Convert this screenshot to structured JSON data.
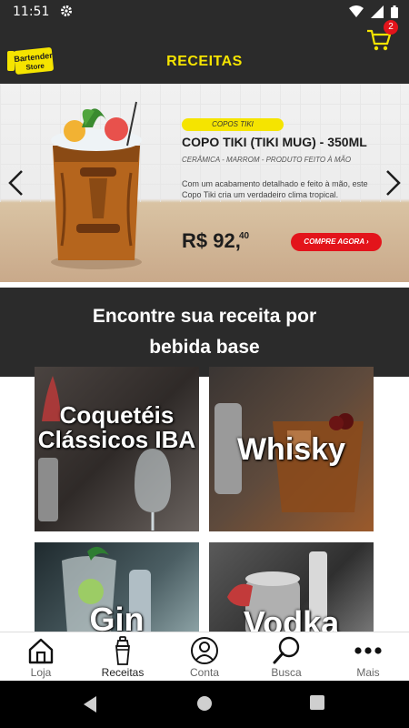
{
  "status_bar": {
    "time": "11:51",
    "icons": [
      "gear-icon",
      "wifi-icon",
      "signal-icon",
      "battery-icon"
    ]
  },
  "header": {
    "logo_text_top": "Bartender",
    "logo_text_bottom": "Store",
    "title": "RECEITAS",
    "cart_count": "2",
    "accent_color": "#f5e400"
  },
  "banner": {
    "category": "COPOS TIKI",
    "product_title": "COPO TIKI (TIKI MUG) - 350ML",
    "product_subtitle": "CERÂMICA - MARROM - PRODUTO FEITO À MÃO",
    "description": "Com um acabamento detalhado e feito à mão, este Copo Tiki cria um verdadeiro clima tropical.",
    "price_main": "R$ 92,",
    "price_cents": "40",
    "buy_label": "COMPRE AGORA  ›",
    "prev_icon": "chevron-left-icon",
    "next_icon": "chevron-right-icon",
    "buy_color": "#e3141b"
  },
  "section": {
    "title": "Encontre sua receita por bebida base"
  },
  "categories": [
    {
      "label": "Coquetéis Clássicos IBA"
    },
    {
      "label": "Whisky"
    },
    {
      "label": "Gin"
    },
    {
      "label": "Vodka"
    }
  ],
  "nav": {
    "items": [
      {
        "label": "Loja",
        "icon": "home-icon"
      },
      {
        "label": "Receitas",
        "icon": "shaker-icon"
      },
      {
        "label": "Conta",
        "icon": "account-icon"
      },
      {
        "label": "Busca",
        "icon": "search-icon"
      },
      {
        "label": "Mais",
        "icon": "more-icon"
      }
    ],
    "active": "Receitas"
  }
}
